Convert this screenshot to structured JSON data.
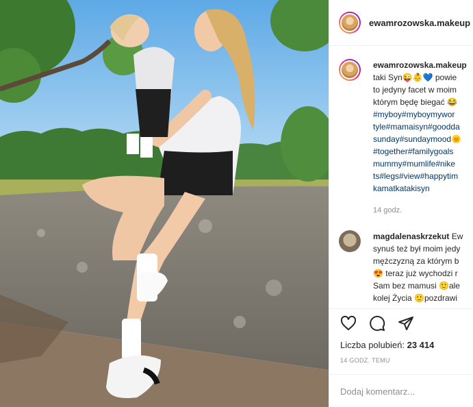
{
  "post": {
    "author": "ewamrozowska.makeup",
    "caption_author": "ewamrozowska.makeup",
    "caption_lines": [
      "taki Syn😜👶💙 powie",
      "to jedyny facet w moim",
      "którym będę biegać 😂"
    ],
    "hashtag_lines": [
      "#myboy#myboymywor",
      "tyle#mamaisyn#goodda",
      "sunday#sundaymood🌞",
      "#together#familygoals",
      "mummy#mumlife#nike",
      "ts#legs#view#happytim",
      "kamatkatakisyn"
    ],
    "caption_time": "14 godz.",
    "comment": {
      "user": "magdalenaskrzekut",
      "first_word": "Ew",
      "lines": [
        "synuś też był moim jedy",
        "mężczyzną za którym b",
        "😍 teraz już wychodzi r",
        "Sam bez mamusi 🙂ale",
        "kolej Życia 🙂pozdrawi"
      ]
    },
    "likes_label": "Liczba polubień:",
    "likes_count": "23 414",
    "timestamp": "14 GODZ. TEMU",
    "add_comment_placeholder": "Dodaj komentarz..."
  },
  "icons": {
    "like": "heart-icon",
    "comment": "comment-icon",
    "share": "paper-plane-icon"
  }
}
